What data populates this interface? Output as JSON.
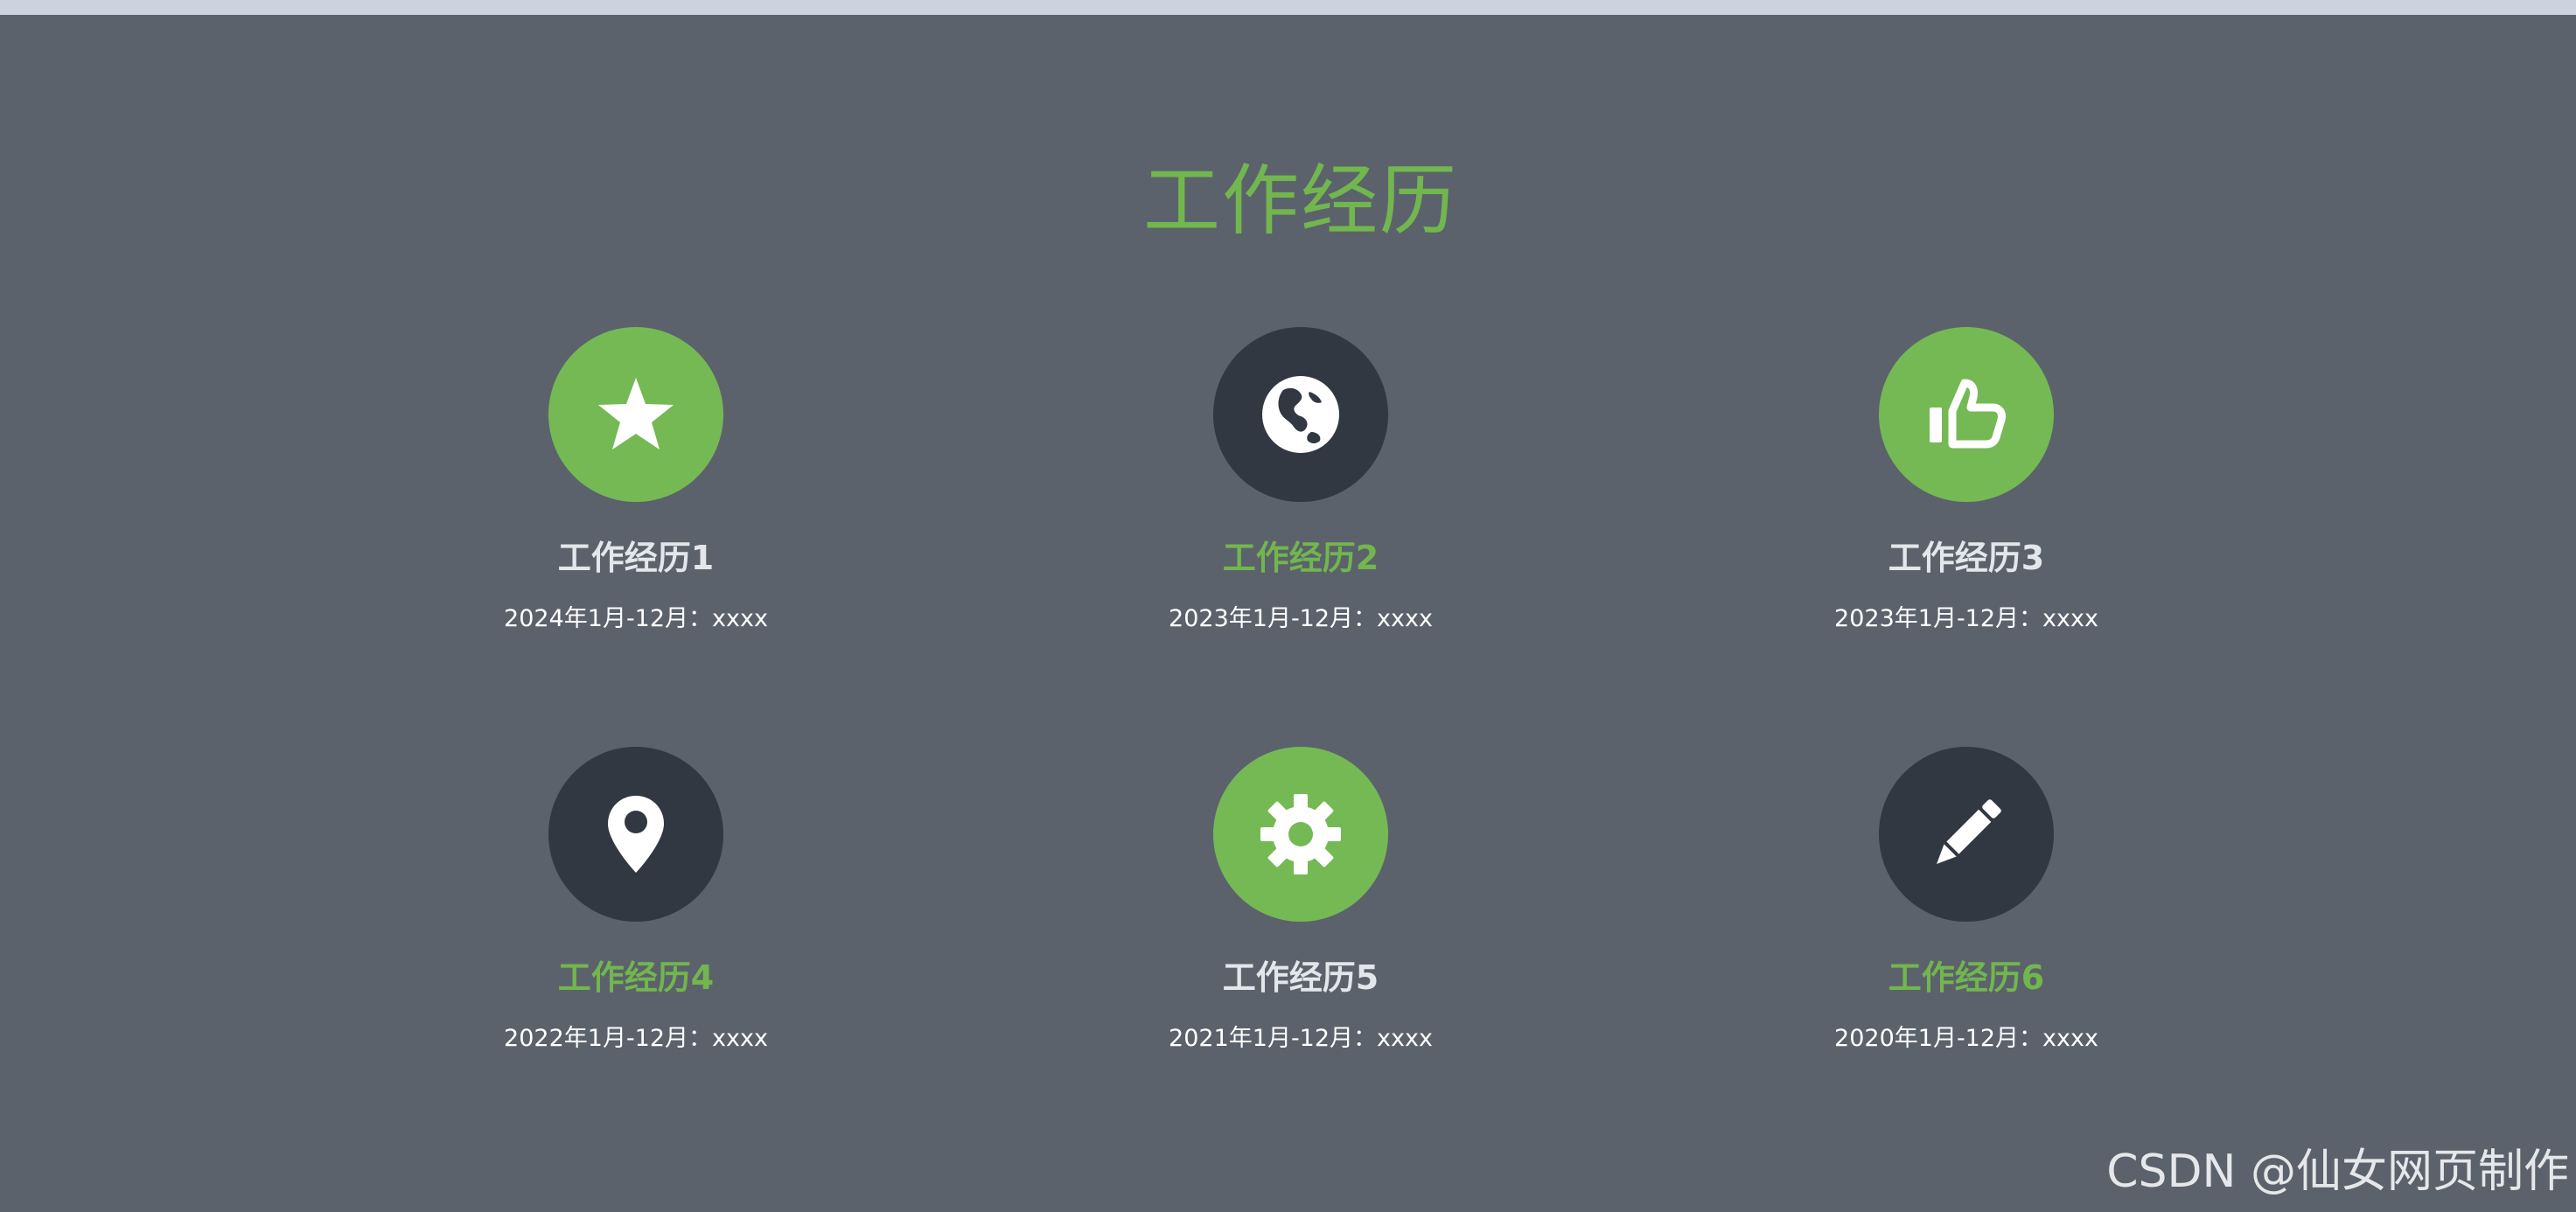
{
  "section": {
    "title": "工作经历"
  },
  "items": [
    {
      "title": "工作经历1",
      "date": "2024年1月-12月：xxxx",
      "icon": "star-icon",
      "circle_color": "#75b954",
      "title_color": "#e3e6ea"
    },
    {
      "title": "工作经历2",
      "date": "2023年1月-12月：xxxx",
      "icon": "globe-icon",
      "circle_color": "#323842",
      "title_color": "#72b64e"
    },
    {
      "title": "工作经历3",
      "date": "2023年1月-12月：xxxx",
      "icon": "thumbs-up-icon",
      "circle_color": "#75b954",
      "title_color": "#e3e6ea"
    },
    {
      "title": "工作经历4",
      "date": "2022年1月-12月：xxxx",
      "icon": "map-marker-icon",
      "circle_color": "#323842",
      "title_color": "#72b64e"
    },
    {
      "title": "工作经历5",
      "date": "2021年1月-12月：xxxx",
      "icon": "gear-icon",
      "circle_color": "#75b954",
      "title_color": "#e3e6ea"
    },
    {
      "title": "工作经历6",
      "date": "2020年1月-12月：xxxx",
      "icon": "pencil-icon",
      "circle_color": "#323842",
      "title_color": "#72b64e"
    }
  ],
  "watermark": {
    "text": "CSDN @仙女网页制作"
  },
  "colors": {
    "background": "#5b626c",
    "top_strip": "#ccd3df",
    "accent_green": "#72b64e",
    "circle_green": "#75b954",
    "circle_dark": "#323842"
  }
}
